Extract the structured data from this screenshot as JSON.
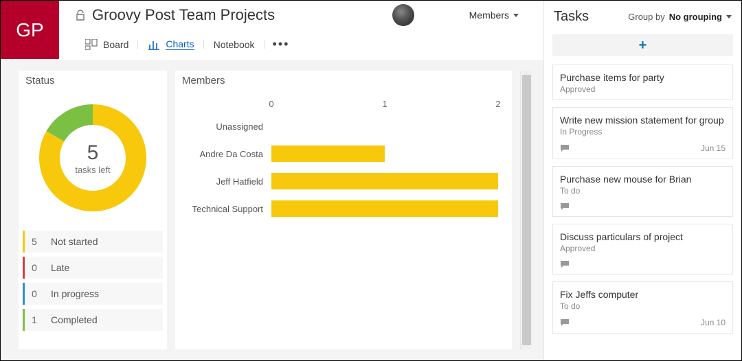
{
  "branding": {
    "initials": "GP"
  },
  "header": {
    "title": "Groovy Post Team Projects",
    "members_label": "Members"
  },
  "tabs": {
    "board": "Board",
    "charts": "Charts",
    "notebook": "Notebook"
  },
  "status_card": {
    "title": "Status",
    "center_number": "5",
    "center_label": "tasks left"
  },
  "status_legend": [
    {
      "count": "5",
      "label": "Not started",
      "color": "#f8c80c"
    },
    {
      "count": "0",
      "label": "Late",
      "color": "#d83b3b"
    },
    {
      "count": "0",
      "label": "In progress",
      "color": "#2a8dd4"
    },
    {
      "count": "1",
      "label": "Completed",
      "color": "#7bc043"
    }
  ],
  "members_card": {
    "title": "Members"
  },
  "right": {
    "title": "Tasks",
    "group_by_label": "Group by",
    "group_by_value": "No grouping"
  },
  "tasks": [
    {
      "title": "Purchase items for party",
      "status": "Approved",
      "has_comment": false,
      "date": ""
    },
    {
      "title": "Write new mission statement for group",
      "status": "In Progress",
      "has_comment": true,
      "date": "Jun 15"
    },
    {
      "title": "Purchase new mouse for Brian",
      "status": "To do",
      "has_comment": true,
      "date": ""
    },
    {
      "title": "Discuss particulars of project",
      "status": "Approved",
      "has_comment": true,
      "date": ""
    },
    {
      "title": "Fix Jeffs computer",
      "status": "To do",
      "has_comment": true,
      "date": "Jun 10"
    }
  ],
  "chart_data": {
    "donut": {
      "type": "pie",
      "title": "Status",
      "series": [
        {
          "name": "Not started",
          "value": 5,
          "color": "#f8c80c"
        },
        {
          "name": "Late",
          "value": 0,
          "color": "#d83b3b"
        },
        {
          "name": "In progress",
          "value": 0,
          "color": "#2a8dd4"
        },
        {
          "name": "Completed",
          "value": 1,
          "color": "#7bc043"
        }
      ],
      "center_value": 5,
      "center_label": "tasks left"
    },
    "bars": {
      "type": "bar",
      "title": "Members",
      "xlabel": "",
      "ylabel": "",
      "xlim": [
        0,
        2
      ],
      "ticks": [
        0,
        1,
        2
      ],
      "categories": [
        "Unassigned",
        "Andre Da Costa",
        "Jeff Hatfield",
        "Technical Support"
      ],
      "values": [
        0,
        1,
        2,
        2
      ],
      "color": "#f8c80c"
    }
  }
}
